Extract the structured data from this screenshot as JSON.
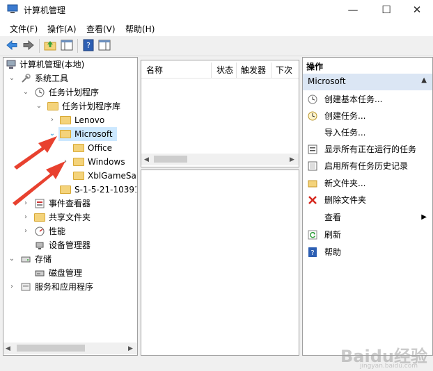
{
  "window": {
    "title": "计算机管理",
    "minimize_glyph": "—",
    "maximize_glyph": "☐",
    "close_glyph": "✕"
  },
  "menu": [
    "文件(F)",
    "操作(A)",
    "查看(V)",
    "帮助(H)"
  ],
  "tree": {
    "root": "计算机管理(本地)",
    "system_tools": "系统工具",
    "task_scheduler": "任务计划程序",
    "task_library": "任务计划程序库",
    "lenovo": "Lenovo",
    "microsoft": "Microsoft",
    "office": "Office",
    "windows": "Windows",
    "xblgamesave": "XblGameSa",
    "sid": "S-1-5-21-10391",
    "event_viewer": "事件查看器",
    "shared_folders": "共享文件夹",
    "performance": "性能",
    "device_manager": "设备管理器",
    "storage": "存储",
    "disk_management": "磁盘管理",
    "services_apps": "服务和应用程序"
  },
  "columns": [
    "名称",
    "状态",
    "触发器",
    "下次"
  ],
  "actions": {
    "header": "操作",
    "section": "Microsoft",
    "items": [
      {
        "label": "创建基本任务...",
        "icon": "create-basic-task-icon"
      },
      {
        "label": "创建任务...",
        "icon": "create-task-icon"
      },
      {
        "label": "导入任务...",
        "icon": ""
      },
      {
        "label": "显示所有正在运行的任务",
        "icon": "running-tasks-icon"
      },
      {
        "label": "启用所有任务历史记录",
        "icon": "history-icon"
      },
      {
        "label": "新文件夹...",
        "icon": "new-folder-icon"
      },
      {
        "label": "删除文件夹",
        "icon": "delete-icon"
      },
      {
        "label": "查看",
        "icon": ""
      },
      {
        "label": "刷新",
        "icon": "refresh-icon"
      },
      {
        "label": "帮助",
        "icon": "help-icon"
      }
    ]
  },
  "watermark": {
    "brand": "Baidu经验",
    "url": "jingyan.baidu.com"
  },
  "colors": {
    "selection": "#cce8ff",
    "action_header": "#dbe6f4",
    "arrow": "#e8412f"
  }
}
